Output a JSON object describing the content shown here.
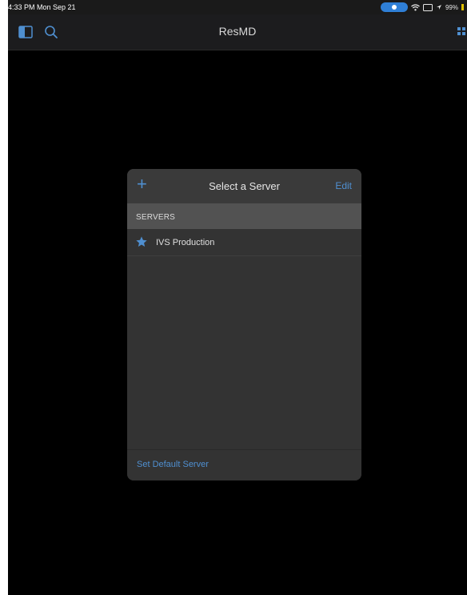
{
  "status_bar": {
    "time_date": "4:33 PM  Mon Sep 21",
    "battery": "99%"
  },
  "nav": {
    "title": "ResMD",
    "left_icons": [
      "sidebar-toggle-icon",
      "search-icon"
    ],
    "right_icons": [
      "grid-menu-icon"
    ]
  },
  "server_dialog": {
    "add_label": "+",
    "title": "Select a Server",
    "edit_label": "Edit",
    "section_header": "SERVERS",
    "servers": [
      {
        "label": "IVS Production",
        "icon": "star-icon",
        "default": true
      }
    ],
    "footer_link": "Set Default Server"
  },
  "colors": {
    "accent": "#4f8fd0",
    "background": "#000000",
    "dialog": "#333333",
    "section_header": "#525252"
  }
}
